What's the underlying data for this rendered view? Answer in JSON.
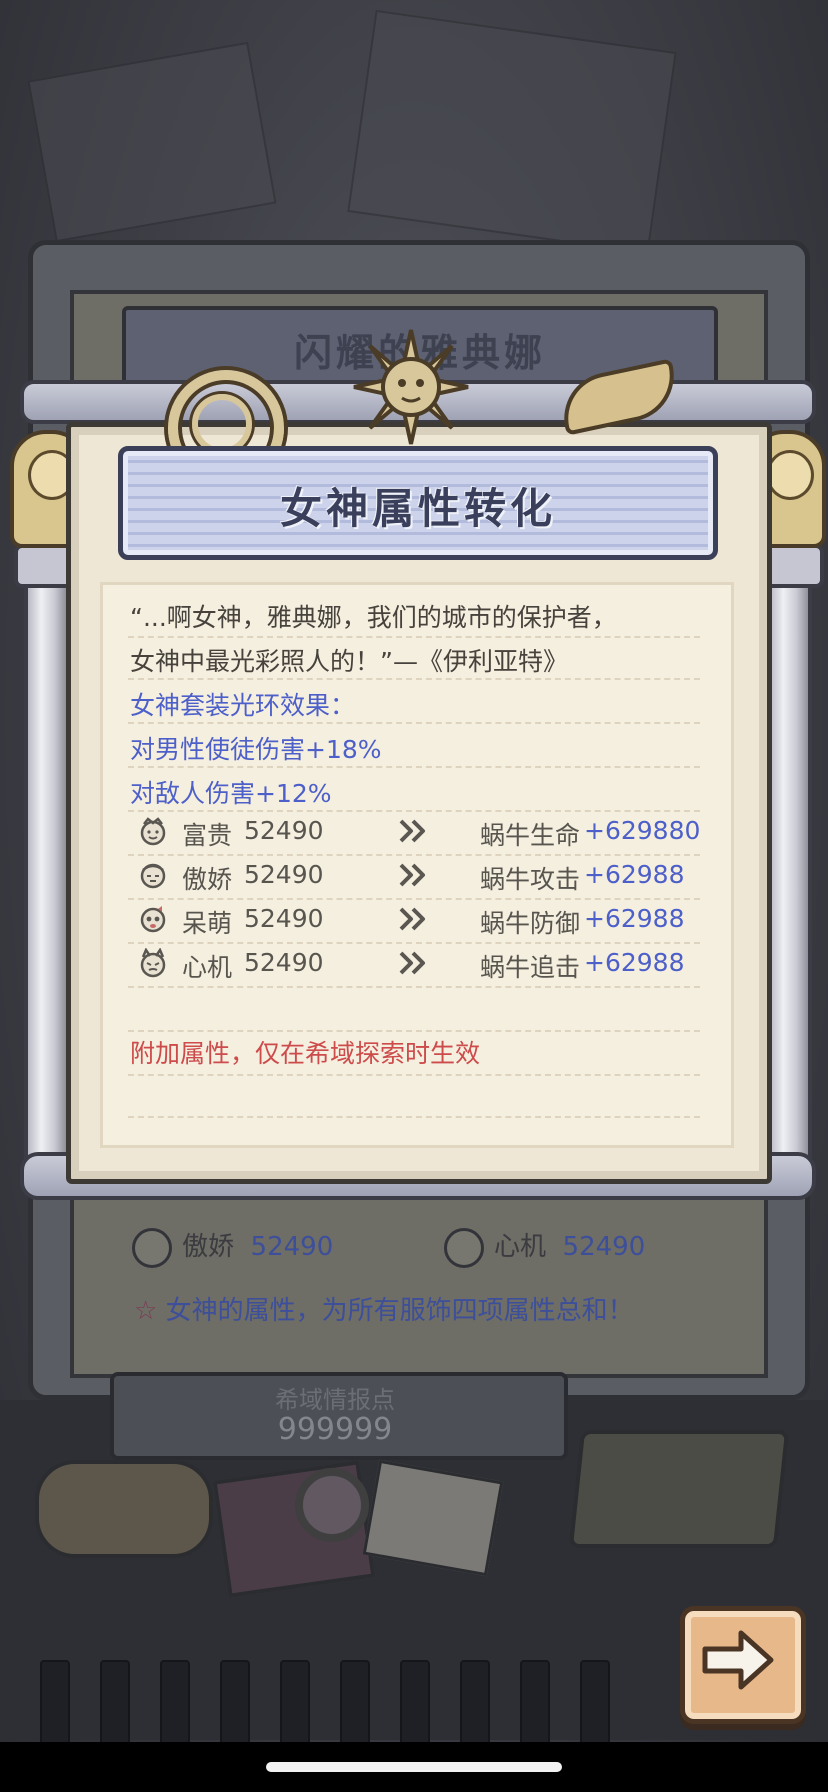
{
  "back_panel": {
    "banner_title": "闪耀的雅典娜",
    "rows": [
      {
        "left_name": "傲娇",
        "left_value": "52490",
        "right_name": "心机",
        "right_value": "52490"
      }
    ],
    "note": "女神的属性，为所有服饰四项属性总和！",
    "bottom_label": "希域情报点",
    "bottom_value": "999999"
  },
  "dialog": {
    "title": "女神属性转化",
    "quote_line1": "“...啊女神，雅典娜，我们的城市的保护者，",
    "quote_line2": "女神中最光彩照人的！”—《伊利亚特》",
    "aura_heading": "女神套装光环效果：",
    "aura_1": "对男性使徒伤害+18%",
    "aura_2": "对敌人伤害+12%",
    "rows": [
      {
        "icon": "rich-face-icon",
        "name": "富贵",
        "value": "52490",
        "stat": "蜗牛生命",
        "bonus": "+629880"
      },
      {
        "icon": "proud-face-icon",
        "name": "傲娇",
        "value": "52490",
        "stat": "蜗牛攻击",
        "bonus": "+62988"
      },
      {
        "icon": "cute-face-icon",
        "name": "呆萌",
        "value": "52490",
        "stat": "蜗牛防御",
        "bonus": "+62988"
      },
      {
        "icon": "scheming-face-icon",
        "name": "心机",
        "value": "52490",
        "stat": "蜗牛追击",
        "bonus": "+62988"
      }
    ],
    "footnote": "附加属性，仅在希域探索时生效"
  },
  "colors": {
    "accent_blue": "#4d5fc8",
    "warning_red": "#cd4b4b",
    "panel_bg": "#efe7d6"
  }
}
